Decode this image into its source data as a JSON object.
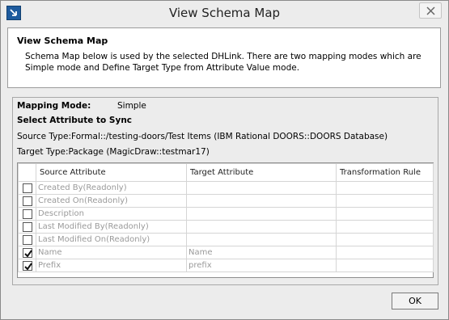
{
  "window": {
    "title": "View Schema Map"
  },
  "description": {
    "title": "View Schema Map",
    "text": "Schema Map below is used by the selected DHLink. There are two mapping modes which are Simple mode and Define Target Type from Attribute Value mode."
  },
  "mapping": {
    "mode_label": "Mapping Mode:",
    "mode_value": "Simple",
    "section_title": "Select Attribute to Sync",
    "source_type": "Source Type:Formal::/testing-doors/Test Items (IBM Rational DOORS::DOORS Database)",
    "target_type": "Target Type:Package (MagicDraw::testmar17)"
  },
  "table": {
    "columns": [
      "",
      "Source Attribute",
      "Target Attribute",
      "Transformation Rule"
    ],
    "rows": [
      {
        "checked": false,
        "source": "Created By(Readonly)",
        "target": "",
        "rule": ""
      },
      {
        "checked": false,
        "source": "Created On(Readonly)",
        "target": "",
        "rule": ""
      },
      {
        "checked": false,
        "source": "Description",
        "target": "",
        "rule": ""
      },
      {
        "checked": false,
        "source": "Last Modified By(Readonly)",
        "target": "",
        "rule": ""
      },
      {
        "checked": false,
        "source": "Last Modified On(Readonly)",
        "target": "",
        "rule": ""
      },
      {
        "checked": true,
        "source": "Name",
        "target": "Name",
        "rule": ""
      },
      {
        "checked": true,
        "source": "Prefix",
        "target": "prefix",
        "rule": ""
      }
    ]
  },
  "buttons": {
    "ok": "OK"
  },
  "colors": {
    "panel_border": "#9c9c9c",
    "dim_text": "#9a9a9a",
    "background": "#ececec"
  }
}
